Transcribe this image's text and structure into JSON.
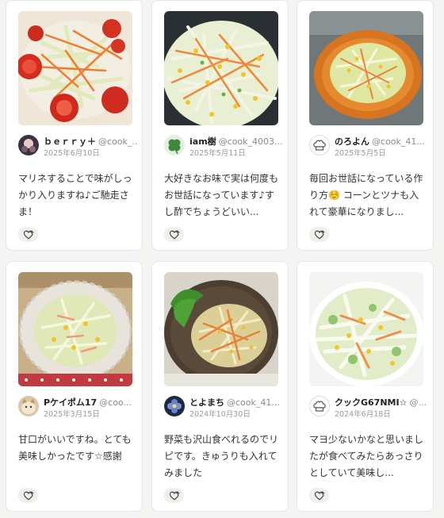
{
  "cards": [
    {
      "author_name": "ｂｅｒｒｙ＋",
      "author_id": "@cook_...",
      "date": "2025年6月10日",
      "comment": "マリネすることで味がしっかり入りますね♪ご馳走さま！",
      "avatar_icon": "photo-avatar",
      "like_icon": "heart-plus-icon"
    },
    {
      "author_name": "iam樹",
      "author_id": "@cook_4003...",
      "date": "2025年5月11日",
      "comment": "大好きなお味で実は何度もお世話になっています♪すし酢でちょうどいい...",
      "avatar_icon": "clover-avatar",
      "like_icon": "heart-plus-icon"
    },
    {
      "author_name": "のろよん",
      "author_id": "@cook_41...",
      "date": "2025年5月5日",
      "comment": "毎回お世話になっている作り方☺️ コーンとツナも入れて豪華になりまし...",
      "avatar_icon": "chef-hat-avatar",
      "like_icon": "heart-plus-icon"
    },
    {
      "author_name": "Pケイポム17",
      "author_id": "@coo...",
      "date": "2025年3月15日",
      "comment": "甘口がいいですね。とても美味しかったです☆感謝",
      "avatar_icon": "cat-avatar",
      "like_icon": "heart-plus-icon"
    },
    {
      "author_name": "とよまち",
      "author_id": "@cook_41...",
      "date": "2024年10月30日",
      "comment": "野菜も沢山食べれるのでリピです。きゅうりも入れてみました",
      "avatar_icon": "flower-avatar",
      "like_icon": "heart-plus-icon"
    },
    {
      "author_name": "クックG67NMI☆",
      "author_id": "@...",
      "date": "2024年6月18日",
      "comment": "マヨ少ないかなと思いましたが食べてみたらあっさりとしていて美味し...",
      "avatar_icon": "chef-hat-avatar",
      "like_icon": "heart-plus-icon"
    }
  ],
  "colors": {
    "background": "#f4f4f2",
    "card": "#ffffff",
    "text": "#333333",
    "muted": "#9a9a9a"
  }
}
